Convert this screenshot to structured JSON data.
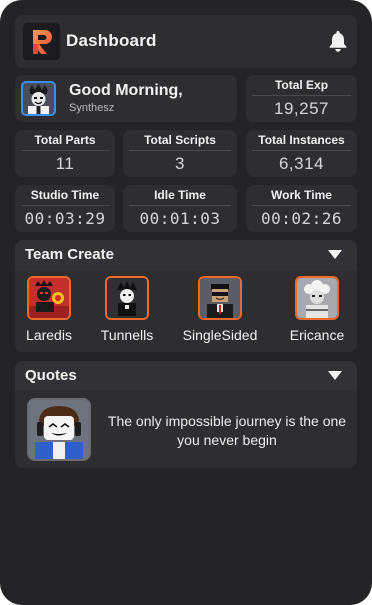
{
  "header": {
    "title": "Dashboard",
    "logo_icon": "r-logo-icon",
    "notify_icon": "bell-icon"
  },
  "profile": {
    "greeting": "Good Morning,",
    "username": "Synthesz"
  },
  "stats": {
    "total_exp": {
      "label": "Total Exp",
      "value": "19,257"
    },
    "total_parts": {
      "label": "Total Parts",
      "value": "11"
    },
    "total_scripts": {
      "label": "Total Scripts",
      "value": "3"
    },
    "total_instances": {
      "label": "Total Instances",
      "value": "6,314"
    },
    "studio_time": {
      "label": "Studio Time",
      "value": "00:03:29"
    },
    "idle_time": {
      "label": "Idle Time",
      "value": "00:01:03"
    },
    "work_time": {
      "label": "Work Time",
      "value": "00:02:26"
    }
  },
  "team_create": {
    "title": "Team Create",
    "members": [
      {
        "name": "Laredis"
      },
      {
        "name": "Tunnells"
      },
      {
        "name": "SingleSided"
      },
      {
        "name": "Ericance"
      }
    ]
  },
  "quotes": {
    "title": "Quotes",
    "text": "The only impossible journey is the one you never begin"
  },
  "colors": {
    "accent_orange": "#ee6a2a",
    "accent_blue": "#3d8df5",
    "card": "#2e2e31",
    "background": "#242426"
  }
}
